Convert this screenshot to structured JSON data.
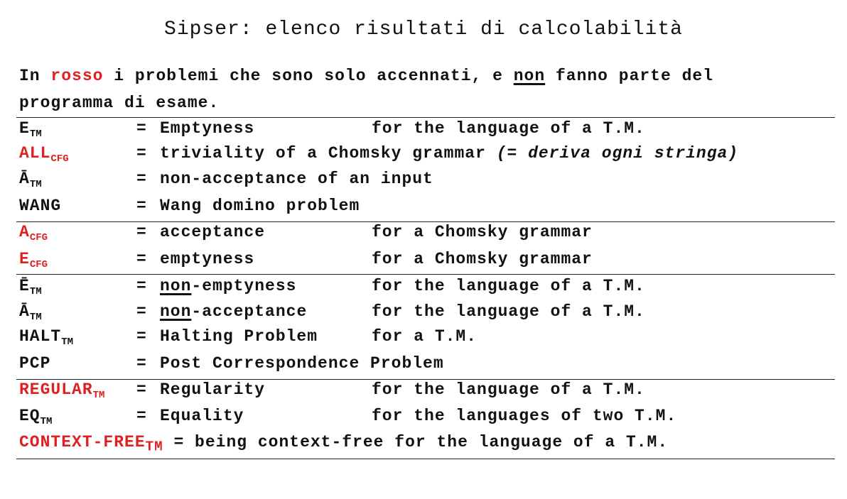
{
  "title": "Sipser: elenco risultati di calcolabilità",
  "intro": {
    "p1": "In ",
    "red_word": "rosso",
    "p2": " i problemi che sono solo accennati, e ",
    "non": "non",
    "p3": " fanno parte del",
    "line2": "programma di esame."
  },
  "rows": [
    {
      "sym": "E",
      "sub": "TM",
      "eq": "=",
      "desc": "Emptyness",
      "ctx": "for the language of a T.M."
    },
    {
      "sym": "ALL",
      "sub": "CFG",
      "eq": "=",
      "desc": "triviality of a Chomsky grammar",
      "note": "(= deriva ogni stringa)"
    },
    {
      "sym": "Ā",
      "sub": "TM",
      "eq": "=",
      "desc": "non-acceptance of an input"
    },
    {
      "sym": "WANG",
      "eq": "=",
      "desc": "Wang domino problem"
    },
    {
      "sym": "A",
      "sub": "CFG",
      "eq": "=",
      "desc": "acceptance",
      "ctx": "for a Chomsky grammar"
    },
    {
      "sym": "E",
      "sub": "CFG",
      "eq": "=",
      "desc": "emptyness",
      "ctx": "for a Chomsky grammar"
    },
    {
      "sym": "Ē",
      "sub": "TM",
      "eq": "=",
      "desc_non": "non",
      "desc_rest": "-emptyness",
      "ctx": "for the language of a T.M."
    },
    {
      "sym": "Ā",
      "sub": "TM",
      "eq": "=",
      "desc_non": "non",
      "desc_rest": "-acceptance",
      "ctx": "for the language of a T.M."
    },
    {
      "sym": "HALT",
      "sub": "TM",
      "eq": "=",
      "desc": "Halting Problem",
      "ctx": "for a T.M."
    },
    {
      "sym": "PCP",
      "eq": "=",
      "desc": "Post Correspondence Problem"
    },
    {
      "sym": "REGULAR",
      "sub": "TM",
      "eq": "=",
      "desc": "Regularity",
      "ctx": "for the language of a T.M."
    },
    {
      "sym": "EQ",
      "sub": "TM",
      "eq": "=",
      "desc": "Equality",
      "ctx": "for the languages of two T.M."
    },
    {
      "sym": "CONTEXT-FREE",
      "sub": "TM",
      "rest": " = being context-free for the language of a T.M."
    }
  ],
  "colors": {
    "red": "#e02020",
    "text": "#111111"
  }
}
